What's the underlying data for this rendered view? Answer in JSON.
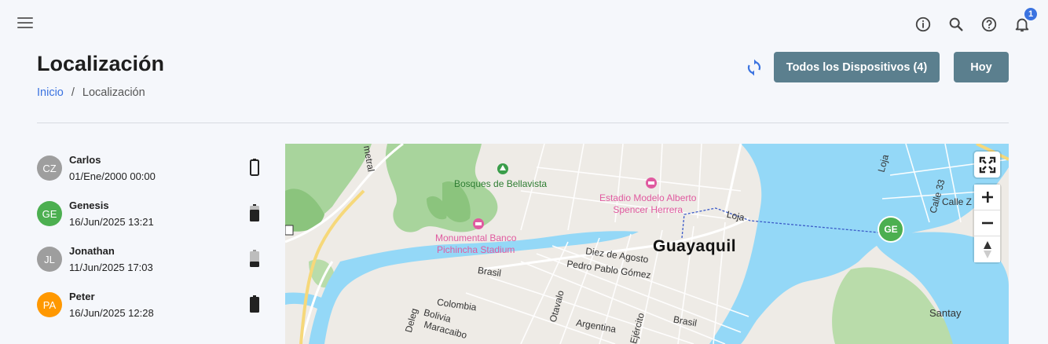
{
  "topbar": {
    "icons": [
      "menu-icon",
      "info-icon",
      "search-icon",
      "help-icon",
      "bell-icon"
    ],
    "notification_count": "1"
  },
  "header": {
    "title": "Localización",
    "breadcrumb": {
      "home": "Inicio",
      "separator": "/",
      "current": "Localización"
    },
    "buttons": {
      "all_devices": "Todos los Dispositivos (4)",
      "today": "Hoy"
    }
  },
  "colors": {
    "accent": "#3b73e0",
    "button": "#5b7f8e",
    "water": "#94d8f7",
    "park": "#a6d39a"
  },
  "devices": [
    {
      "initials": "CZ",
      "name": "Carlos",
      "date": "01/Ene/2000 00:00",
      "avatar_color": "#9e9e9e",
      "battery": "empty"
    },
    {
      "initials": "GE",
      "name": "Genesis",
      "date": "16/Jun/2025 13:21",
      "avatar_color": "#4caf50",
      "battery": "medium"
    },
    {
      "initials": "JL",
      "name": "Jonathan",
      "date": "11/Jun/2025 17:03",
      "avatar_color": "#9e9e9e",
      "battery": "low"
    },
    {
      "initials": "PA",
      "name": "Peter",
      "date": "16/Jun/2025 12:28",
      "avatar_color": "#ff9800",
      "battery": "full"
    }
  ],
  "map": {
    "city": "Guayaquil",
    "marker": "GE",
    "pois": {
      "park": "Bosques de Bellavista",
      "stadium1_line1": "Estadio Modelo Alberto",
      "stadium1_line2": "Spencer Herrera",
      "stadium2_line1": "Monumental Banco",
      "stadium2_line2": "Pichincha Stadium"
    },
    "streets": {
      "s1": "Loja",
      "s2": "Diez de Agosto",
      "s3": "Pedro Pablo Gómez",
      "s4": "Brasil",
      "s5": "Colombia",
      "s6": "Bolivia",
      "s7": "Maracaibo",
      "s8": "Deleg",
      "s9": "Otavalo",
      "s10": "Argentina",
      "s11": "Ejército",
      "s12": "Brasil",
      "s13": "Calle 33",
      "s14": "Calle Z",
      "s15": "Loja",
      "s16": "metral"
    },
    "places": {
      "santay": "Santay"
    },
    "controls": {
      "fullscreen": "fullscreen-icon",
      "zoom_in": "+",
      "zoom_out": "−",
      "compass": "compass-icon"
    }
  }
}
